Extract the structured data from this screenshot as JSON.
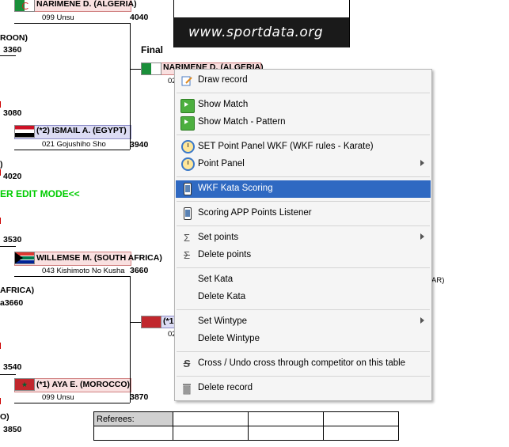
{
  "banner": {
    "url": "www.sportdata.org"
  },
  "bracket": {
    "final_label": "Final",
    "edit_mode_text": "ER EDIT MODE<<",
    "top_upper": {
      "name": "NARIMENE D. (ALGERIA)",
      "kata": "099 Unsu",
      "score": "4040"
    },
    "top_lower": {
      "name": "(*2) ISMAIL A. (EGYPT)",
      "kata": "021 Gojushiho Sho",
      "score": "3940"
    },
    "final_competitor": {
      "name": "NARIMENE D. (ALGERIA)",
      "kata": "02"
    },
    "bottom_upper": {
      "name": "WILLEMSE M. (SOUTH AFRICA)",
      "kata": "043 Kishimoto No Kusha",
      "score": "3660"
    },
    "bottom_lower": {
      "name": "(*1) AYA E. (MOROCCO)",
      "kata": "099 Unsu",
      "score": "3870"
    },
    "final_lower": {
      "name": "(*1",
      "kata": "02"
    },
    "left_fragments": {
      "rooon": "ROON)",
      "s3360": "3360",
      "s3080": "3080",
      "paren1": ")",
      "s4020": "4020",
      "s3530": "3530",
      "africa": "AFRICA)",
      "a3660": "a3660",
      "s3540": "3540",
      "paren2": "O)",
      "s3850": "3850"
    },
    "right_fragment": "AR)"
  },
  "context_menu": {
    "items": [
      {
        "label": "Draw record",
        "icon": "draw-record-icon"
      },
      {
        "label": "Show Match",
        "icon": "play-icon"
      },
      {
        "label": "Show Match - Pattern",
        "icon": "play-icon"
      },
      {
        "label": "SET Point Panel WKF (WKF rules - Karate)",
        "icon": "stopwatch-icon"
      },
      {
        "label": "Point Panel",
        "icon": "stopwatch-icon",
        "submenu": true
      },
      {
        "label": "WKF Kata Scoring",
        "icon": "phone-icon",
        "selected": true
      },
      {
        "label": "Scoring APP Points Listener",
        "icon": "phone-icon"
      },
      {
        "label": "Set points",
        "icon": "sigma-icon",
        "submenu": true
      },
      {
        "label": "Delete points",
        "icon": "sigma-strike-icon"
      },
      {
        "label": "Set Kata"
      },
      {
        "label": "Delete Kata"
      },
      {
        "label": "Set Wintype",
        "submenu": true
      },
      {
        "label": "Delete Wintype"
      },
      {
        "label": "Cross / Undo cross through competitor on this table",
        "icon": "strikethrough-s-icon"
      },
      {
        "label": "Delete record",
        "icon": "trash-icon"
      }
    ]
  },
  "referees": {
    "label": "Referees:"
  },
  "colors": {
    "selection": "#2f69c2",
    "edit_mode": "#00cc00",
    "red_corner": "#f9e0e0",
    "blue_corner": "#dcdcf4"
  }
}
